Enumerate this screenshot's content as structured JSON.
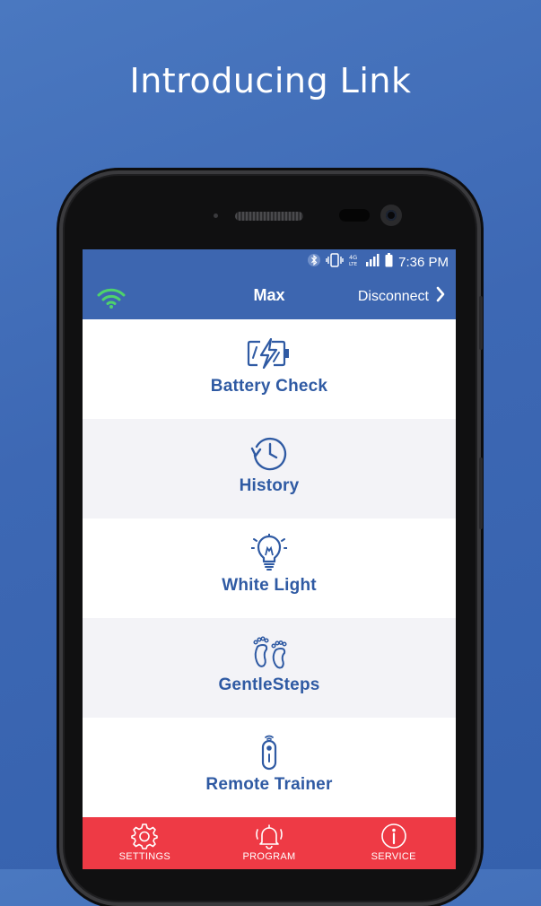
{
  "headline": "Introducing Link",
  "status_bar": {
    "time": "7:36 PM",
    "icons": [
      "bluetooth-icon",
      "vibrate-icon",
      "4g-lte-icon",
      "signal-icon",
      "battery-icon"
    ]
  },
  "app_bar": {
    "title": "Max",
    "disconnect_label": "Disconnect",
    "wifi_color": "#4ed36b"
  },
  "menu": {
    "items": [
      {
        "label": "Battery Check",
        "icon": "battery-bolt-icon"
      },
      {
        "label": "History",
        "icon": "history-clock-icon"
      },
      {
        "label": "White Light",
        "icon": "light-bulb-icon"
      },
      {
        "label": "GentleSteps",
        "icon": "footprints-icon"
      },
      {
        "label": "Remote Trainer",
        "icon": "remote-icon"
      }
    ]
  },
  "bottom_nav": {
    "tabs": [
      {
        "label": "SETTINGS",
        "icon": "gear-icon"
      },
      {
        "label": "PROGRAM",
        "icon": "bell-icon"
      },
      {
        "label": "SERVICE",
        "icon": "info-icon"
      }
    ]
  },
  "colors": {
    "background": "#3d68b4",
    "app_bar": "#3d66b0",
    "accent_text": "#2f5aa3",
    "bottom_nav": "#ee3a45"
  }
}
